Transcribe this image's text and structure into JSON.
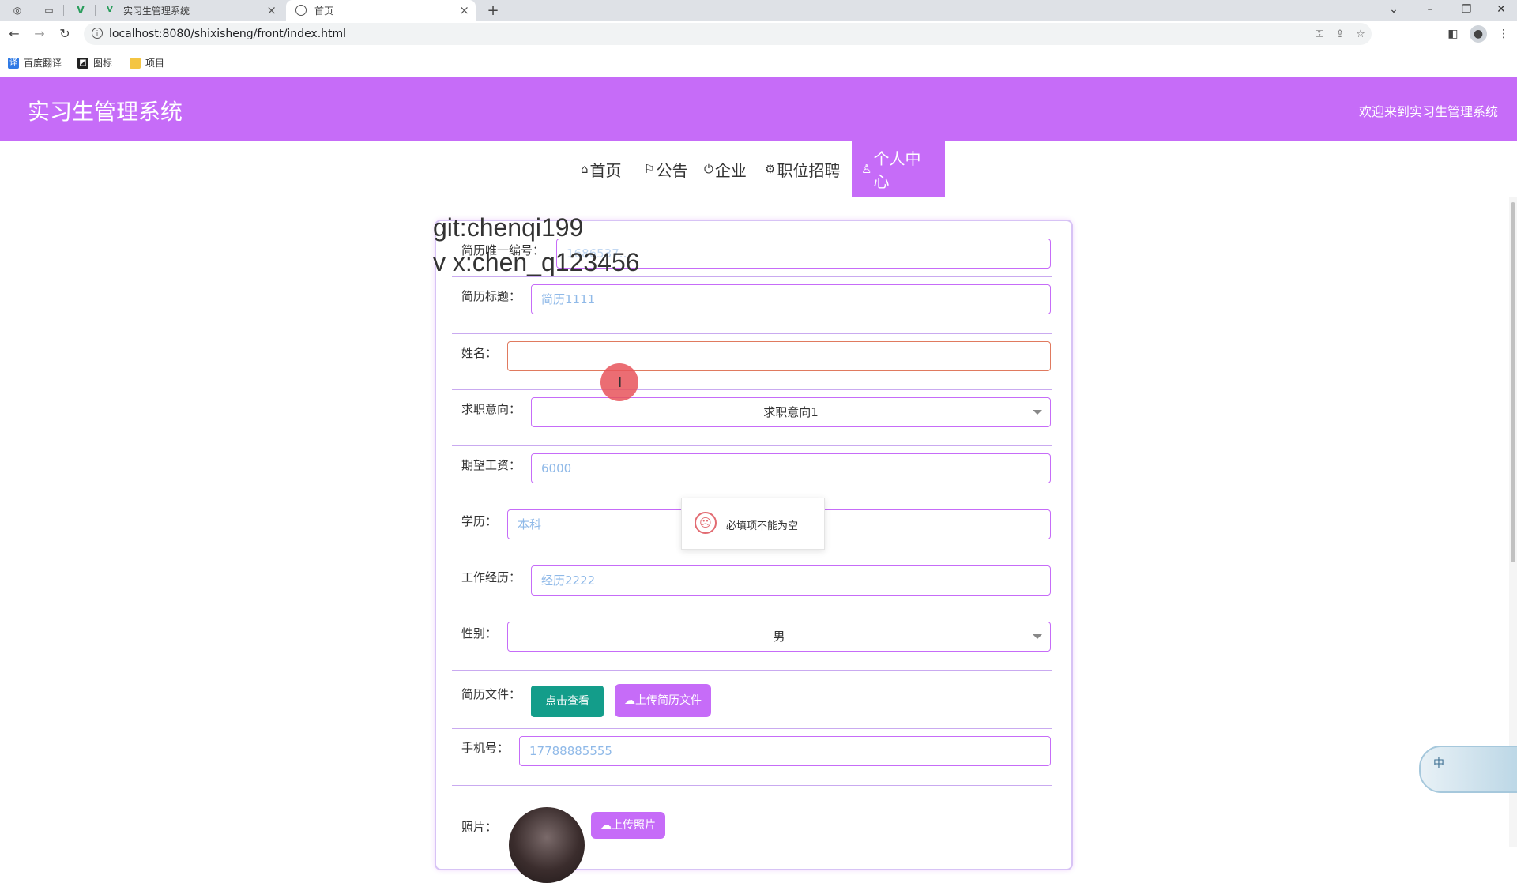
{
  "browser": {
    "tabs": [
      {
        "title": "实习生管理系统",
        "active": false
      },
      {
        "title": "首页",
        "active": true
      }
    ],
    "new_tab": "+",
    "url": "localhost:8080/shixisheng/front/index.html",
    "bookmarks": [
      "百度翻译",
      "图标",
      "项目"
    ]
  },
  "site": {
    "title": "实习生管理系统",
    "welcome": "欢迎来到实习生管理系统",
    "nav": [
      {
        "label": "首页",
        "icon": "home-icon"
      },
      {
        "label": "公告",
        "icon": "flag-icon"
      },
      {
        "label": "企业",
        "icon": "power-icon"
      },
      {
        "label": "职位招聘",
        "icon": "settings-icon"
      },
      {
        "label": "个人中心",
        "icon": "user-icon",
        "active": true
      }
    ]
  },
  "form": {
    "resume_id": {
      "label": "简历唯一编号：",
      "value": "1686537..."
    },
    "resume_title": {
      "label": "简历标题：",
      "value": "简历1111"
    },
    "name": {
      "label": "姓名：",
      "value": ""
    },
    "intention": {
      "label": "求职意向：",
      "value": "求职意向1"
    },
    "salary": {
      "label": "期望工资：",
      "value": "6000"
    },
    "education": {
      "label": "学历：",
      "value": "本科"
    },
    "experience": {
      "label": "工作经历：",
      "value": "经历2222"
    },
    "gender": {
      "label": "性别：",
      "value": "男"
    },
    "resume_file": {
      "label": "简历文件：",
      "view_button": "点击查看",
      "upload_button": "上传简历文件"
    },
    "phone": {
      "label": "手机号：",
      "value": "17788885555"
    },
    "photo": {
      "label": "照片：",
      "upload_button": "上传照片"
    }
  },
  "toast": {
    "message": "必填项不能为空"
  },
  "watermark": {
    "line1": "git:chenqi199",
    "line2": "v x:chen_q123456"
  },
  "float_widget": {
    "label": "中"
  },
  "colors": {
    "primary": "#c66cf8",
    "teal": "#139d8a",
    "error": "#e26b72"
  }
}
